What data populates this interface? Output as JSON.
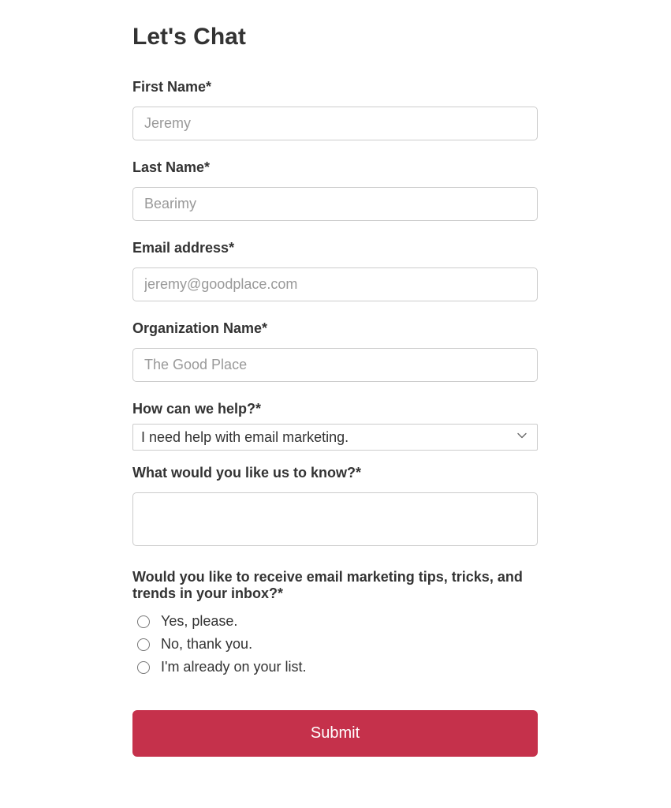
{
  "form": {
    "title": "Let's Chat",
    "first_name": {
      "label": "First Name*",
      "placeholder": "Jeremy"
    },
    "last_name": {
      "label": "Last Name*",
      "placeholder": "Bearimy"
    },
    "email": {
      "label": "Email address*",
      "placeholder": "jeremy@goodplace.com"
    },
    "organization": {
      "label": "Organization Name*",
      "placeholder": "The Good Place"
    },
    "help": {
      "label": "How can we help?*",
      "selected": "I need help with email marketing."
    },
    "message": {
      "label": "What would you like us to know?*"
    },
    "subscribe": {
      "label": "Would you like to receive email marketing tips, tricks, and trends in your inbox?*",
      "options": {
        "yes": "Yes, please.",
        "no": "No, thank you.",
        "already": "I'm already on your list."
      }
    },
    "submit_label": "Submit"
  }
}
